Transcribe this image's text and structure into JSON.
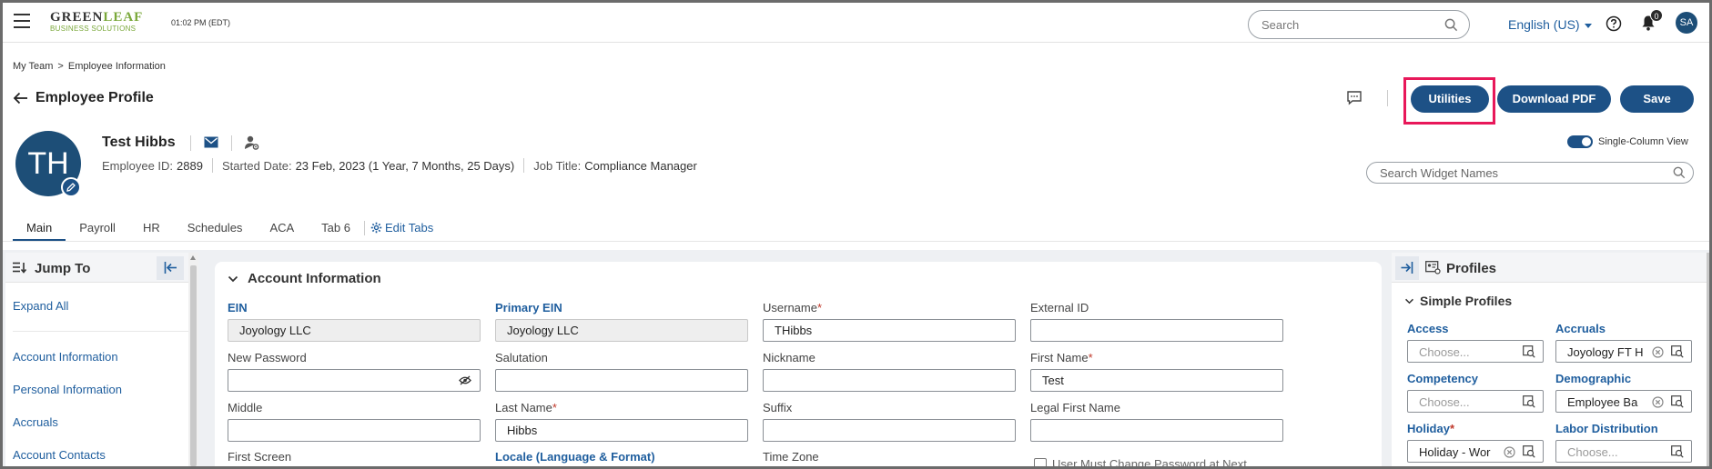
{
  "app": {
    "logo_main_a": "GREEN",
    "logo_main_b": "LEAF",
    "logo_sub": "BUSINESS SOLUTIONS",
    "clock": "01:02 PM (EDT)",
    "search_placeholder": "Search",
    "language": "English (US)",
    "notifications_count": "0",
    "user_initials": "SA"
  },
  "breadcrumb": {
    "items": [
      "My Team",
      "Employee Information"
    ],
    "separator": ">"
  },
  "page": {
    "title": "Employee Profile"
  },
  "toolbar": {
    "utilities": "Utilities",
    "download_pdf": "Download PDF",
    "save": "Save"
  },
  "employee": {
    "initials": "TH",
    "name": "Test Hibbs",
    "id_label": "Employee ID:",
    "id": "2889",
    "started_label": "Started Date:",
    "started": "23 Feb, 2023 (1 Year, 7 Months, 25 Days)",
    "job_label": "Job Title:",
    "job": "Compliance Manager"
  },
  "view": {
    "single_column_label": "Single-Column View",
    "widget_search_placeholder": "Search Widget Names"
  },
  "tabs": {
    "items": [
      "Main",
      "Payroll",
      "HR",
      "Schedules",
      "ACA",
      "Tab 6"
    ],
    "edit": "Edit Tabs",
    "active": "Main"
  },
  "jump_to": {
    "title": "Jump To",
    "expand_all": "Expand All",
    "links": [
      "Account Information",
      "Personal Information",
      "Accruals",
      "Account Contacts"
    ]
  },
  "account": {
    "title": "Account Information",
    "ein_label": "EIN",
    "ein": "Joyology LLC",
    "primary_ein_label": "Primary EIN",
    "primary_ein": "Joyology LLC",
    "username_label": "Username",
    "username": "THibbs",
    "external_id_label": "External ID",
    "external_id": "",
    "new_password_label": "New Password",
    "new_password": "",
    "salutation_label": "Salutation",
    "salutation": "",
    "nickname_label": "Nickname",
    "nickname": "",
    "first_name_label": "First Name",
    "first_name": "Test",
    "middle_label": "Middle",
    "middle": "",
    "last_name_label": "Last Name",
    "last_name": "Hibbs",
    "suffix_label": "Suffix",
    "suffix": "",
    "legal_first_name_label": "Legal First Name",
    "legal_first_name": "",
    "first_screen_label": "First Screen",
    "locale_label": "Locale (Language & Format)",
    "time_zone_label": "Time Zone",
    "must_change_label": "User Must Change Password at Next",
    "required_mark": "*"
  },
  "profiles": {
    "title": "Profiles",
    "simple_title": "Simple Profiles",
    "access_label": "Access",
    "access": "Choose...",
    "accruals_label": "Accruals",
    "accruals": "Joyology FT H",
    "competency_label": "Competency",
    "competency": "Choose...",
    "demographic_label": "Demographic",
    "demographic": "Employee Ba",
    "holiday_label": "Holiday",
    "holiday": "Holiday - Wor",
    "labor_label": "Labor Distribution",
    "labor": "Choose...",
    "required_mark": "*"
  },
  "colors": {
    "primary": "#1d5186",
    "link": "#1f5e9e",
    "highlight": "#e8185a",
    "brand_green": "#7aa83a"
  }
}
